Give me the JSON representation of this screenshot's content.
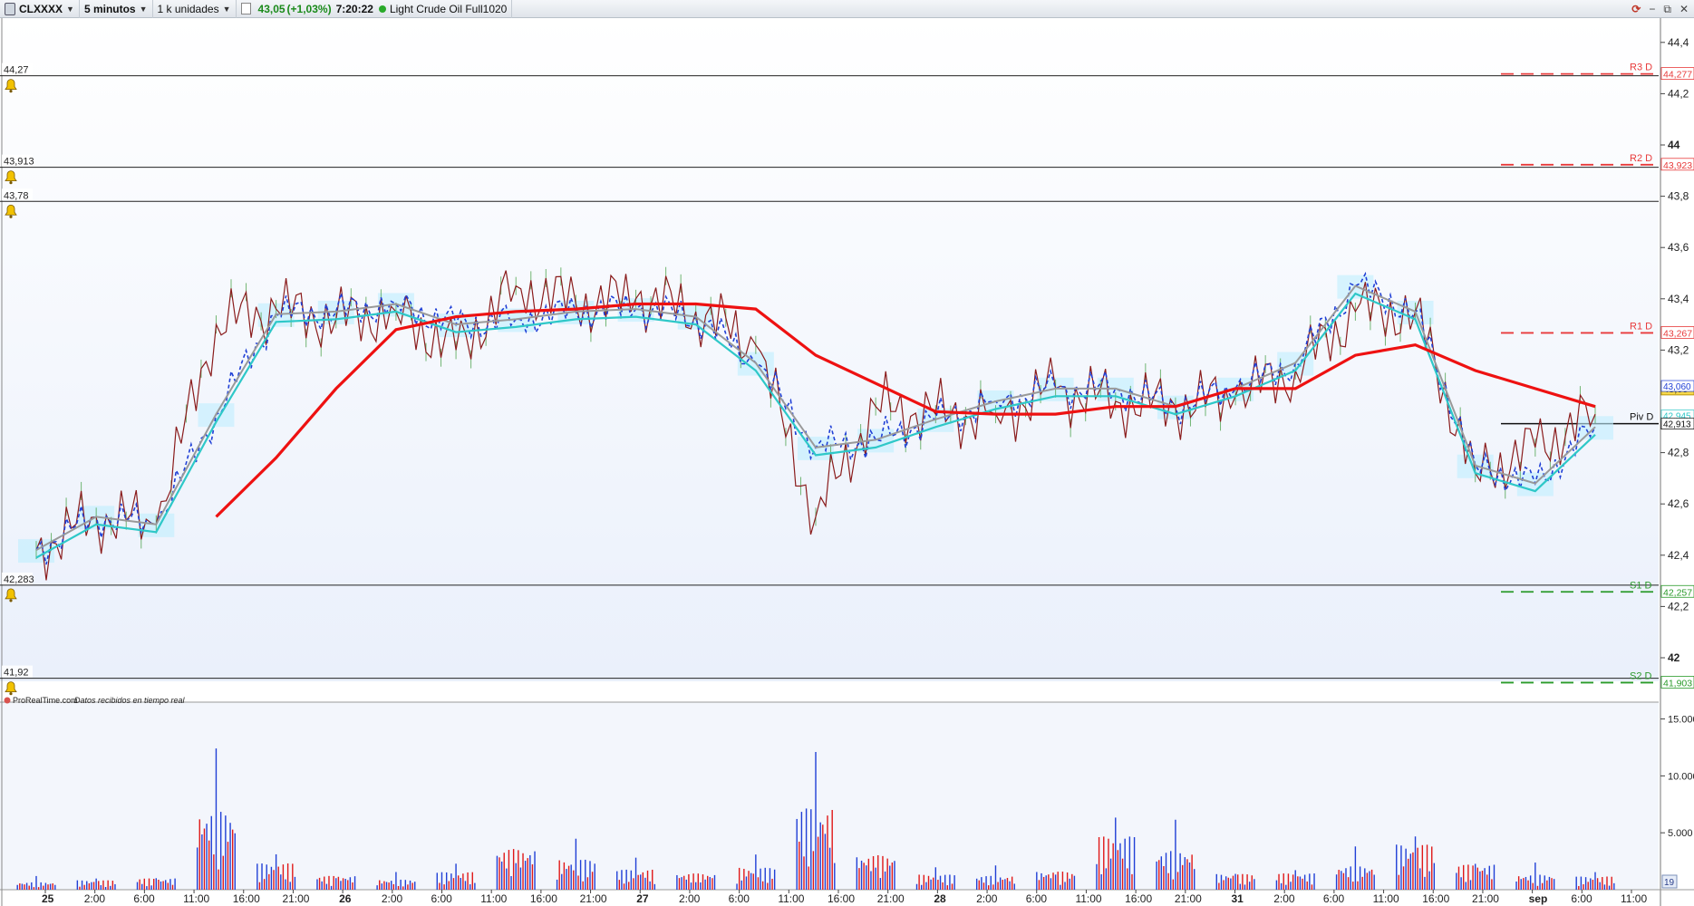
{
  "toolbar": {
    "symbol": "CLXXXX",
    "timeframe": "5 minutos",
    "units": "1 k unidades",
    "price": "43,05",
    "change": "(+1,03%)",
    "time": "7:20:22",
    "instrument": "Light Crude Oil Full1020"
  },
  "window_controls": [
    "−",
    "⧉",
    "✕"
  ],
  "price_axis": {
    "ticks": [
      "44,4",
      "44,2",
      "44",
      "43,8",
      "43,6",
      "43,4",
      "43,2",
      "42,8",
      "42,6",
      "42,4",
      "42,2",
      "42"
    ],
    "current_price_tag": "43,05",
    "tags": [
      "43,060",
      "42,945",
      "42,913"
    ]
  },
  "alert_lines": [
    {
      "value": "44,27",
      "price": 44.27
    },
    {
      "value": "43,913",
      "price": 43.913
    },
    {
      "value": "43,78",
      "price": 43.78
    },
    {
      "value": "42,283",
      "price": 42.283
    },
    {
      "value": "41,92",
      "price": 41.92
    }
  ],
  "pivots": [
    {
      "label": "R3 D",
      "value": "44,277",
      "price": 44.277,
      "color": "#e83a3a"
    },
    {
      "label": "R2 D",
      "value": "43,923",
      "price": 43.923,
      "color": "#e83a3a"
    },
    {
      "label": "R1 D",
      "value": "43,267",
      "price": 43.267,
      "color": "#e83a3a"
    },
    {
      "label": "Piv D",
      "value": "42,913",
      "price": 42.913,
      "color": "#111111"
    },
    {
      "label": "S1 D",
      "value": "42,257",
      "price": 42.257,
      "color": "#2a9a2a"
    },
    {
      "label": "S2 D",
      "value": "41,903",
      "price": 41.903,
      "color": "#2a9a2a"
    }
  ],
  "volume_panel": {
    "source": "ProRealTime.com",
    "status": "Datos recibidos en tiempo real",
    "ticks": [
      "15.000",
      "10.000",
      "5.000"
    ],
    "counter": "19"
  },
  "time_axis": [
    {
      "label": "25",
      "bold": true
    },
    {
      "label": "2:00"
    },
    {
      "label": "6:00"
    },
    {
      "label": "11:00"
    },
    {
      "label": "16:00"
    },
    {
      "label": "21:00"
    },
    {
      "label": "26",
      "bold": true
    },
    {
      "label": "2:00"
    },
    {
      "label": "6:00"
    },
    {
      "label": "11:00"
    },
    {
      "label": "16:00"
    },
    {
      "label": "21:00"
    },
    {
      "label": "27",
      "bold": true
    },
    {
      "label": "2:00"
    },
    {
      "label": "6:00"
    },
    {
      "label": "11:00"
    },
    {
      "label": "16:00"
    },
    {
      "label": "21:00"
    },
    {
      "label": "28",
      "bold": true
    },
    {
      "label": "2:00"
    },
    {
      "label": "6:00"
    },
    {
      "label": "11:00"
    },
    {
      "label": "16:00"
    },
    {
      "label": "21:00"
    },
    {
      "label": "31",
      "bold": true
    },
    {
      "label": "2:00"
    },
    {
      "label": "6:00"
    },
    {
      "label": "11:00"
    },
    {
      "label": "16:00"
    },
    {
      "label": "21:00"
    },
    {
      "label": "sep",
      "bold": true
    },
    {
      "label": "6:00"
    },
    {
      "label": "11:00"
    }
  ],
  "colors": {
    "price_line": "#8a1c1c",
    "ma_long": "#ee1111",
    "ma_cyan": "#2ec8c8",
    "ma_dash": "#1f3fd6",
    "ma_grey": "#999999",
    "cloud": "#bfefff",
    "green_bars": "#3a9a3a",
    "volume_up": "#1f3fd6",
    "volume_down": "#e01818",
    "background": "#eaf0fb"
  },
  "chart_data": {
    "type": "line",
    "title": "Light Crude Oil Full1020",
    "ylim": [
      41.9,
      44.5
    ],
    "x": [
      "25 2:00",
      "25 6:00",
      "25 11:00",
      "25 16:00",
      "25 21:00",
      "26 2:00",
      "26 6:00",
      "26 11:00",
      "26 16:00",
      "26 21:00",
      "27 2:00",
      "27 6:00",
      "27 11:00",
      "27 16:00",
      "27 21:00",
      "28 2:00",
      "28 6:00",
      "28 11:00",
      "28 16:00",
      "28 21:00",
      "31 2:00",
      "31 6:00",
      "31 11:00",
      "31 16:00",
      "31 21:00",
      "sep 2:00",
      "sep 6:00"
    ],
    "series": [
      {
        "values": [
          42.42,
          42.55,
          42.52,
          43.3,
          43.36,
          43.32,
          43.35,
          43.2,
          43.45,
          43.38,
          43.4,
          43.35,
          43.22,
          42.55,
          42.98,
          42.95,
          42.95,
          43.05,
          43.0,
          42.98,
          43.02,
          43.12,
          43.35,
          43.35,
          42.72,
          42.82,
          42.95
        ]
      },
      {
        "values": [
          null,
          null,
          null,
          42.55,
          42.78,
          43.05,
          43.28,
          43.33,
          43.35,
          43.36,
          43.38,
          43.38,
          43.36,
          43.18,
          43.07,
          42.96,
          42.95,
          42.95,
          42.98,
          42.98,
          43.05,
          43.05,
          43.18,
          43.22,
          43.12,
          43.05,
          42.98
        ]
      },
      {
        "values": [
          42.42,
          42.55,
          42.52,
          42.95,
          43.34,
          43.35,
          43.38,
          43.3,
          43.32,
          43.35,
          43.36,
          43.33,
          43.15,
          42.82,
          42.85,
          42.93,
          43.0,
          43.05,
          43.05,
          42.98,
          43.05,
          43.15,
          43.45,
          43.35,
          42.75,
          42.68,
          42.9
        ]
      }
    ],
    "volume": [
      1200,
      1500,
      1800,
      12500,
      4200,
      2200,
      1600,
      2800,
      6500,
      4800,
      3200,
      2600,
      3500,
      13000,
      5500,
      2400,
      2200,
      2900,
      8500,
      6200,
      2500,
      2600,
      3800,
      7200,
      4000,
      2400,
      2100
    ]
  }
}
